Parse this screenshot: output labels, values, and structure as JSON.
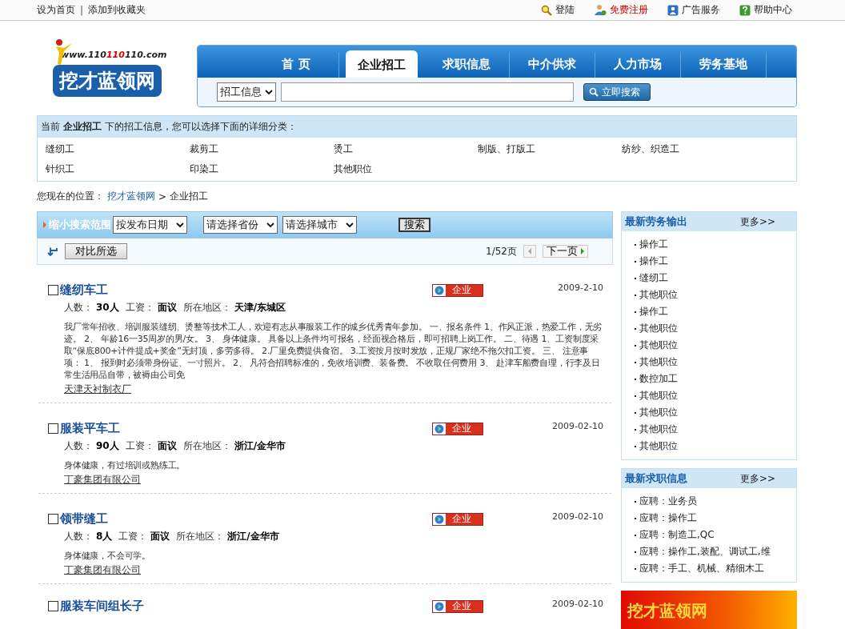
{
  "top_links": [
    {
      "label": "设为首页"
    },
    {
      "label": "添加到收藏夹"
    }
  ],
  "top_separator": "|",
  "user_links": [
    {
      "kind": "login",
      "label": "登陆",
      "highlight": false
    },
    {
      "kind": "register",
      "label": "免费注册",
      "highlight": true
    },
    {
      "kind": "ads",
      "label": "广告服务",
      "highlight": false
    },
    {
      "kind": "help",
      "label": "帮助中心",
      "highlight": false
    }
  ],
  "logo": {
    "url_parts": [
      {
        "text": "www.110",
        "highlight": false
      },
      {
        "text": "110",
        "highlight": true
      },
      {
        "text": "110.com",
        "highlight": false
      }
    ],
    "name": "挖才蓝领网"
  },
  "nav": [
    {
      "label": "首 页",
      "selected": false
    },
    {
      "label": "企业招工",
      "selected": true
    },
    {
      "label": "求职信息",
      "selected": false
    },
    {
      "label": "中介供求",
      "selected": false
    },
    {
      "label": "人力市场",
      "selected": false
    },
    {
      "label": "劳务基地",
      "selected": false
    }
  ],
  "search": {
    "category": "招工信息",
    "button": "立即搜索"
  },
  "category_box": {
    "prefix": "当前",
    "current": "企业招工",
    "suffix": "下的招工信息，您可以选择下面的详细分类：",
    "items": [
      "缝纫工",
      "裁剪工",
      "烫工",
      "制版、打版工",
      "纺纱、织造工",
      "针织工",
      "印染工",
      "其他职位"
    ]
  },
  "breadcrumb": {
    "label": "您现在的位置：",
    "items": [
      {
        "label": "挖才蓝领网",
        "link": true
      },
      {
        "label": "企业招工",
        "link": false
      }
    ],
    "separator": ">"
  },
  "filter": {
    "title": "缩小搜索范围",
    "selects": [
      "按发布日期",
      "请选择省份",
      "请选择城市"
    ],
    "button": "搜索"
  },
  "toolbar": {
    "compare": "对比所选",
    "page": "1/52页",
    "next": "下一页"
  },
  "jobs": [
    {
      "title": "缝纫车工",
      "checked": false,
      "badge": "企业",
      "date": "2009-2-10",
      "fields": [
        {
          "label": "人数：",
          "value": "30人"
        },
        {
          "label": "工资：",
          "value": "面议"
        },
        {
          "label": "所在地区：",
          "value": "天津/东城区"
        }
      ],
      "description": "我厂常年招收、培训服装缝纫、烫整等技术工人，欢迎有志从事服装工作的城乡优秀青年参加。 一、报名条件 1、作风正派，热爱工作，无劣迹。 2、 年龄16一35周岁的男/女。 3、 身体健康。 具备以上条件均可报名，经面视合格后，即可招聘上岗工作。 二、待遇 1、工资制度采取“保底800+计件提成+奖金”无封顶，多劳多得。 2.厂里免费提供食宿。 3.工资按月按时发放，正规厂家绝不拖欠扣工资。 三、 注意事项： 1、 报到时必须带身份证、一寸照片。 2、 凡符合招聘标准的，免收培训费、装备费。 不收取任何费用 3、 赴津车船费自理，行李及日常生活用品自带，被褥由公司免",
      "company": "天津天衬制衣厂"
    },
    {
      "title": "服装平车工",
      "checked": false,
      "badge": "企业",
      "date": "2009-02-10",
      "fields": [
        {
          "label": "人数：",
          "value": "90人"
        },
        {
          "label": "工资：",
          "value": "面议"
        },
        {
          "label": "所在地区：",
          "value": "浙江/金华市"
        }
      ],
      "description": "身体健康，有过培训或熟练工。",
      "company": "丁豪集团有限公司"
    },
    {
      "title": "领带缝工",
      "checked": false,
      "badge": "企业",
      "date": "2009-02-10",
      "fields": [
        {
          "label": "人数：",
          "value": "8人"
        },
        {
          "label": "工资：",
          "value": "面议"
        },
        {
          "label": "所在地区：",
          "value": "浙江/金华市"
        }
      ],
      "description": "身体健康，不会可学。",
      "company": "丁豪集团有限公司"
    },
    {
      "title": "服装车间组长子",
      "checked": false,
      "badge": "企业",
      "date": "2009-02-10"
    }
  ],
  "panels": [
    {
      "title": "最新劳务输出",
      "more": "更多>>",
      "items": [
        "操作工",
        "操作工",
        "缝纫工",
        "其他职位",
        "操作工",
        "其他职位",
        "其他职位",
        "其他职位",
        "数控加工",
        "其他职位",
        "其他职位",
        "其他职位",
        "其他职位"
      ]
    },
    {
      "title": "最新求职信息",
      "more": "更多>>",
      "items": [
        "应聘：业务员",
        "应聘：操作工",
        "应聘：制造工,QC",
        "应聘：操作工,装配、调试工,维",
        "应聘：手工、机械、精细木工"
      ]
    }
  ],
  "banner": {
    "text": "挖才蓝领网"
  }
}
